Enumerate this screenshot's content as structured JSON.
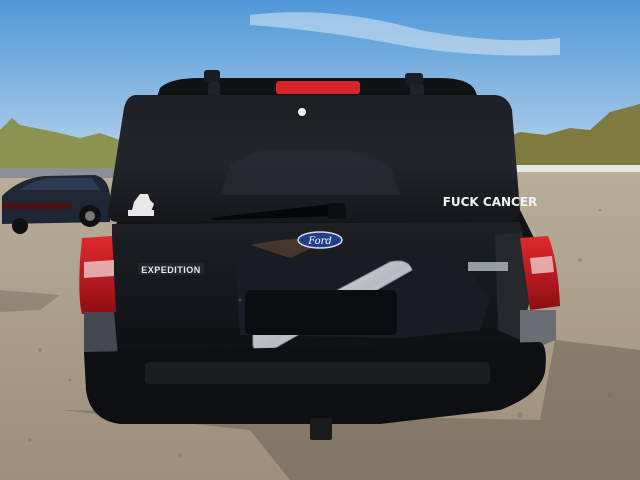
{
  "photo": {
    "subject": "Rear view of a black SUV with a damaged liftgate in a salvage lot",
    "vehicle": {
      "brand_logo_text": "Ford",
      "model_badge_text": "EXPEDITION",
      "rear_window_decal_text": "FUCK CANCER",
      "tail_light_color": "#c8141c",
      "body_color": "#121418"
    },
    "sky_color_top": "#5aa0dc",
    "sky_color_bottom": "#b9d4ea",
    "ground_color": "#a99a87",
    "foliage_color": "#7c8a4a"
  }
}
